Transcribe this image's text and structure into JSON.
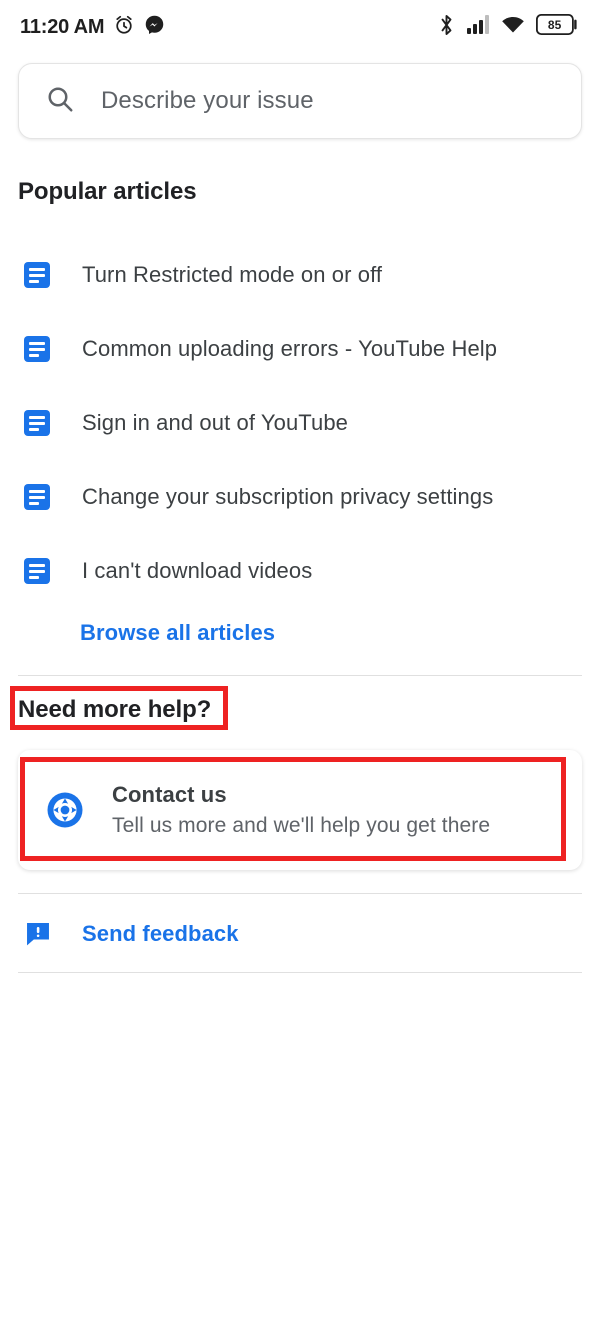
{
  "status_bar": {
    "time": "11:20 AM",
    "left_icons": [
      "alarm-clock-icon",
      "messenger-icon"
    ],
    "right_icons": [
      "bluetooth-icon",
      "cellular-signal-icon",
      "wifi-icon"
    ],
    "battery_level": "85"
  },
  "search": {
    "placeholder": "Describe your issue",
    "value": "",
    "icon": "search-icon"
  },
  "popular": {
    "heading": "Popular articles",
    "articles": [
      {
        "title": "Turn Restricted mode on or off",
        "icon": "article-icon"
      },
      {
        "title": "Common uploading errors - YouTube Help",
        "icon": "article-icon"
      },
      {
        "title": "Sign in and out of YouTube",
        "icon": "article-icon"
      },
      {
        "title": "Change your subscription privacy settings",
        "icon": "article-icon"
      },
      {
        "title": "I can't download videos",
        "icon": "article-icon"
      }
    ],
    "browse_all_label": "Browse all articles"
  },
  "need_more_help": {
    "heading": "Need more help?",
    "contact": {
      "title": "Contact us",
      "subtitle": "Tell us more and we'll help you get there",
      "icon": "support-lifebuoy-icon"
    }
  },
  "feedback": {
    "label": "Send feedback",
    "icon": "feedback-speech-bubble-icon"
  },
  "colors": {
    "accent_blue": "#1a73e8",
    "text_primary": "#3c4043",
    "text_secondary": "#5f6368",
    "annotation_red": "#ee2222",
    "divider": "#e0e0e0"
  }
}
